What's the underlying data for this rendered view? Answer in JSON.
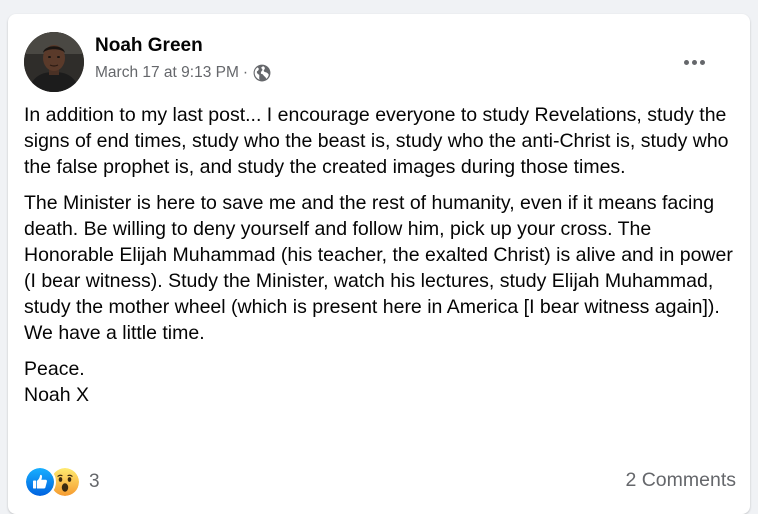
{
  "post": {
    "author": "Noah Green",
    "timestamp": "March 17 at 9:13 PM",
    "separator": "·",
    "audience_icon": "globe-icon",
    "menu_icon": "more-options-icon",
    "paragraphs": [
      "In addition to my last post... I encourage everyone to study Revelations, study the signs of end times, study who the beast is, study who the anti-Christ is, study who the false prophet is, and study the created images during those times.",
      "The Minister is here to save me and the rest of humanity, even if it means facing death. Be willing to deny yourself and follow him, pick up your cross. The Honorable Elijah Muhammad (his teacher, the exalted Christ) is alive and in power (I bear witness). Study the Minister, watch his lectures, study Elijah Muhammad, study the mother wheel (which is present here in America [I bear witness again]). We have a little time."
    ],
    "signature": "Peace.\nNoah X"
  },
  "footer": {
    "reaction_icons": [
      "like-icon",
      "wow-icon"
    ],
    "reaction_count": "3",
    "comments": "2 Comments"
  },
  "colors": {
    "background": "#f0f2f5",
    "card": "#ffffff",
    "secondary_text": "#65676b",
    "like_blue": "#1877f2",
    "wow_yellow": "#f7b928"
  }
}
